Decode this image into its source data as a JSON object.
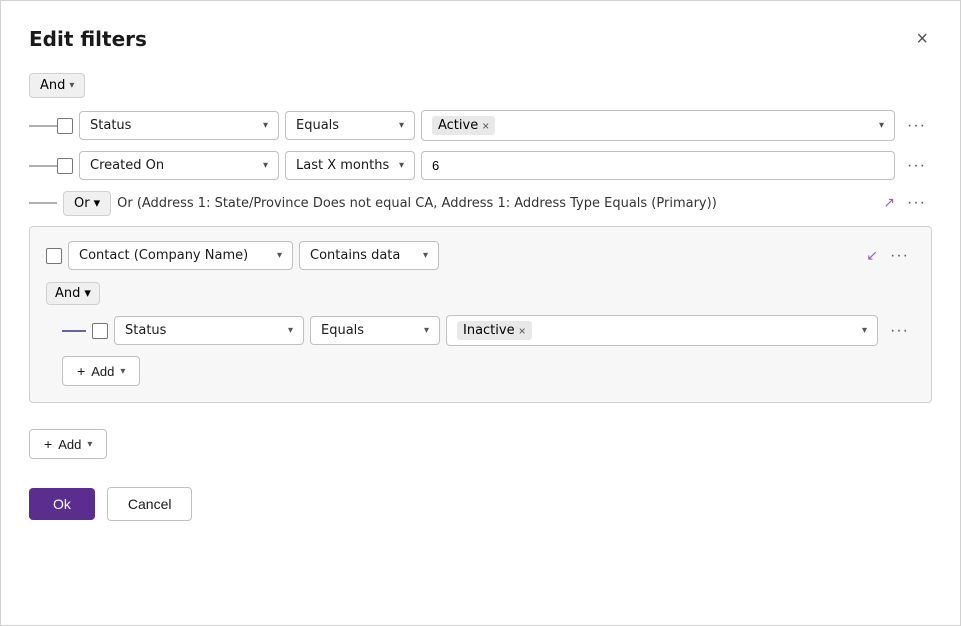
{
  "dialog": {
    "title": "Edit filters",
    "close_label": "×"
  },
  "root_operator": {
    "label": "And",
    "chevron": "▾"
  },
  "rows": [
    {
      "id": "row1",
      "field": "Status",
      "operator": "Equals",
      "value_tag": "Active",
      "more": "···"
    },
    {
      "id": "row2",
      "field": "Created On",
      "operator": "Last X months",
      "value_text": "6",
      "more": "···"
    }
  ],
  "or_row": {
    "badge": "Or",
    "chevron": "▾",
    "text": "Or (Address 1: State/Province Does not equal CA, Address 1: Address Type Equals (Primary))",
    "expand_icon": "↗",
    "more": "···"
  },
  "group": {
    "field": "Contact (Company Name)",
    "operator": "Contains data",
    "collapse_icon": "↙",
    "more": "···",
    "inner_operator": {
      "label": "And",
      "chevron": "▾"
    },
    "inner_row": {
      "field": "Status",
      "operator": "Equals",
      "value_tag": "Inactive",
      "more": "···"
    },
    "inner_add_btn": {
      "plus": "+",
      "label": "Add",
      "chevron": "▾"
    }
  },
  "add_btn": {
    "plus": "+",
    "label": "Add",
    "chevron": "▾"
  },
  "footer": {
    "ok_label": "Ok",
    "cancel_label": "Cancel"
  }
}
